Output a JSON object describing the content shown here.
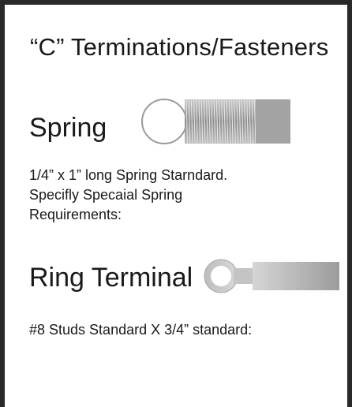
{
  "title": "“C”  Terminations/Fasteners",
  "spring": {
    "label": "Spring",
    "description_lines": [
      "1/4” x 1” long Spring Starndard.",
      "Specifly Specaial Spring",
      "Requirements:"
    ]
  },
  "ring_terminal": {
    "label": "Ring Terminal",
    "description": "#8 Studs Standard X 3/4” standard:"
  },
  "colors": {
    "border": "#2a2a2a",
    "text": "#1a1a1a",
    "spring_gray": "#9a9a9a",
    "terminal_gray": "#a8a8a8"
  },
  "icons": [
    "spring-icon",
    "ring-terminal-icon"
  ]
}
